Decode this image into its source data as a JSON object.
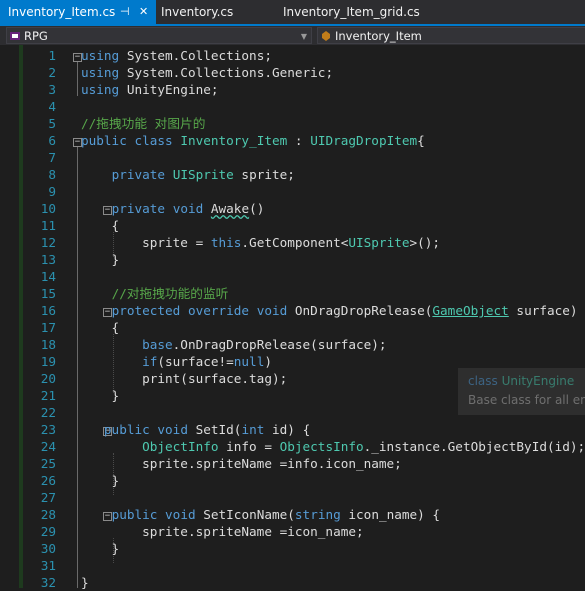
{
  "tabs": [
    {
      "label": "Inventory_Item.cs",
      "active": true
    },
    {
      "label": "Inventory.cs",
      "active": false
    },
    {
      "label": "Inventory_Item_grid.cs",
      "active": false
    }
  ],
  "tab_icons": {
    "pin": "pin-icon",
    "close": "close-icon"
  },
  "nav": {
    "project": "RPG",
    "member": "Inventory_Item"
  },
  "colors": {
    "accent": "#007acc",
    "keyword": "#569cd6",
    "type": "#4ec9b0",
    "comment": "#57a64a",
    "text": "#dcdcdc",
    "line_number": "#2b91af"
  },
  "lines": [
    {
      "n": "1",
      "tokens": [
        [
          "kw",
          "using"
        ],
        [
          "tx",
          " System.Collections;"
        ]
      ]
    },
    {
      "n": "2",
      "tokens": [
        [
          "kw",
          "using"
        ],
        [
          "tx",
          " System.Collections.Generic;"
        ]
      ]
    },
    {
      "n": "3",
      "tokens": [
        [
          "kw",
          "using"
        ],
        [
          "tx",
          " UnityEngine;"
        ]
      ]
    },
    {
      "n": "4",
      "tokens": []
    },
    {
      "n": "5",
      "tokens": [
        [
          "cm",
          "//拖拽功能 对图片的"
        ]
      ]
    },
    {
      "n": "6",
      "tokens": [
        [
          "kw",
          "public"
        ],
        [
          "tx",
          " "
        ],
        [
          "kw",
          "class"
        ],
        [
          "tx",
          " "
        ],
        [
          "ty",
          "Inventory_Item"
        ],
        [
          "tx",
          " : "
        ],
        [
          "ty",
          "UIDragDropItem"
        ],
        [
          "tx",
          "{"
        ]
      ]
    },
    {
      "n": "7",
      "tokens": []
    },
    {
      "n": "8",
      "tokens": [
        [
          "tx",
          "    "
        ],
        [
          "kw",
          "private"
        ],
        [
          "tx",
          " "
        ],
        [
          "ty",
          "UISprite"
        ],
        [
          "tx",
          " sprite;"
        ]
      ]
    },
    {
      "n": "9",
      "tokens": []
    },
    {
      "n": "10",
      "tokens": [
        [
          "tx",
          "    "
        ],
        [
          "kw",
          "private"
        ],
        [
          "tx",
          " "
        ],
        [
          "kw",
          "void"
        ],
        [
          "tx",
          " "
        ],
        [
          "sq",
          "Awake"
        ],
        [
          "tx",
          "()"
        ]
      ]
    },
    {
      "n": "11",
      "tokens": [
        [
          "tx",
          "    {"
        ]
      ]
    },
    {
      "n": "12",
      "tokens": [
        [
          "tx",
          "        sprite = "
        ],
        [
          "kw",
          "this"
        ],
        [
          "tx",
          ".GetComponent<"
        ],
        [
          "ty",
          "UISprite"
        ],
        [
          "tx",
          ">();"
        ]
      ]
    },
    {
      "n": "13",
      "tokens": [
        [
          "tx",
          "    }"
        ]
      ]
    },
    {
      "n": "14",
      "tokens": []
    },
    {
      "n": "15",
      "tokens": [
        [
          "tx",
          "    "
        ],
        [
          "cm",
          "//对拖拽功能的监听"
        ]
      ]
    },
    {
      "n": "16",
      "tokens": [
        [
          "tx",
          "    "
        ],
        [
          "kw",
          "protected"
        ],
        [
          "tx",
          " "
        ],
        [
          "kw",
          "override"
        ],
        [
          "tx",
          " "
        ],
        [
          "kw",
          "void"
        ],
        [
          "tx",
          " OnDragDropRelease("
        ],
        [
          "tl",
          "GameObject"
        ],
        [
          "tx",
          " surface)"
        ]
      ]
    },
    {
      "n": "17",
      "tokens": [
        [
          "tx",
          "    {"
        ]
      ]
    },
    {
      "n": "18",
      "tokens": [
        [
          "tx",
          "        "
        ],
        [
          "kw",
          "base"
        ],
        [
          "tx",
          ".OnDragDropRelease(surface);"
        ]
      ]
    },
    {
      "n": "19",
      "tokens": [
        [
          "tx",
          "        "
        ],
        [
          "kw",
          "if"
        ],
        [
          "tx",
          "(surface!="
        ],
        [
          "kw",
          "null"
        ],
        [
          "tx",
          ")"
        ]
      ]
    },
    {
      "n": "20",
      "tokens": [
        [
          "tx",
          "        print(surface.tag);"
        ]
      ]
    },
    {
      "n": "21",
      "tokens": [
        [
          "tx",
          "    }"
        ]
      ]
    },
    {
      "n": "22",
      "tokens": []
    },
    {
      "n": "23",
      "tokens": [
        [
          "tx",
          "   "
        ],
        [
          "kw",
          "public"
        ],
        [
          "tx",
          " "
        ],
        [
          "kw",
          "void"
        ],
        [
          "tx",
          " SetId("
        ],
        [
          "kw",
          "int"
        ],
        [
          "tx",
          " id) {"
        ]
      ]
    },
    {
      "n": "24",
      "tokens": [
        [
          "tx",
          "        "
        ],
        [
          "ty",
          "ObjectInfo"
        ],
        [
          "tx",
          " info = "
        ],
        [
          "ty",
          "ObjectsInfo"
        ],
        [
          "tx",
          "._instance.GetObjectById(id);"
        ]
      ]
    },
    {
      "n": "25",
      "tokens": [
        [
          "tx",
          "        sprite.spriteName =info.icon_name;"
        ]
      ]
    },
    {
      "n": "26",
      "tokens": [
        [
          "tx",
          "    }"
        ]
      ]
    },
    {
      "n": "27",
      "tokens": []
    },
    {
      "n": "28",
      "tokens": [
        [
          "tx",
          "    "
        ],
        [
          "kw",
          "public"
        ],
        [
          "tx",
          " "
        ],
        [
          "kw",
          "void"
        ],
        [
          "tx",
          " SetIconName("
        ],
        [
          "kw",
          "string"
        ],
        [
          "tx",
          " icon_name) {"
        ]
      ]
    },
    {
      "n": "29",
      "tokens": [
        [
          "tx",
          "        sprite.spriteName =icon_name;"
        ]
      ]
    },
    {
      "n": "30",
      "tokens": [
        [
          "tx",
          "    }"
        ]
      ]
    },
    {
      "n": "31",
      "tokens": []
    },
    {
      "n": "32",
      "tokens": [
        [
          "tx",
          "}"
        ]
      ]
    }
  ],
  "tooltip": {
    "keyword": "class",
    "name": "UnityEngine",
    "description": "Base class for all en"
  }
}
